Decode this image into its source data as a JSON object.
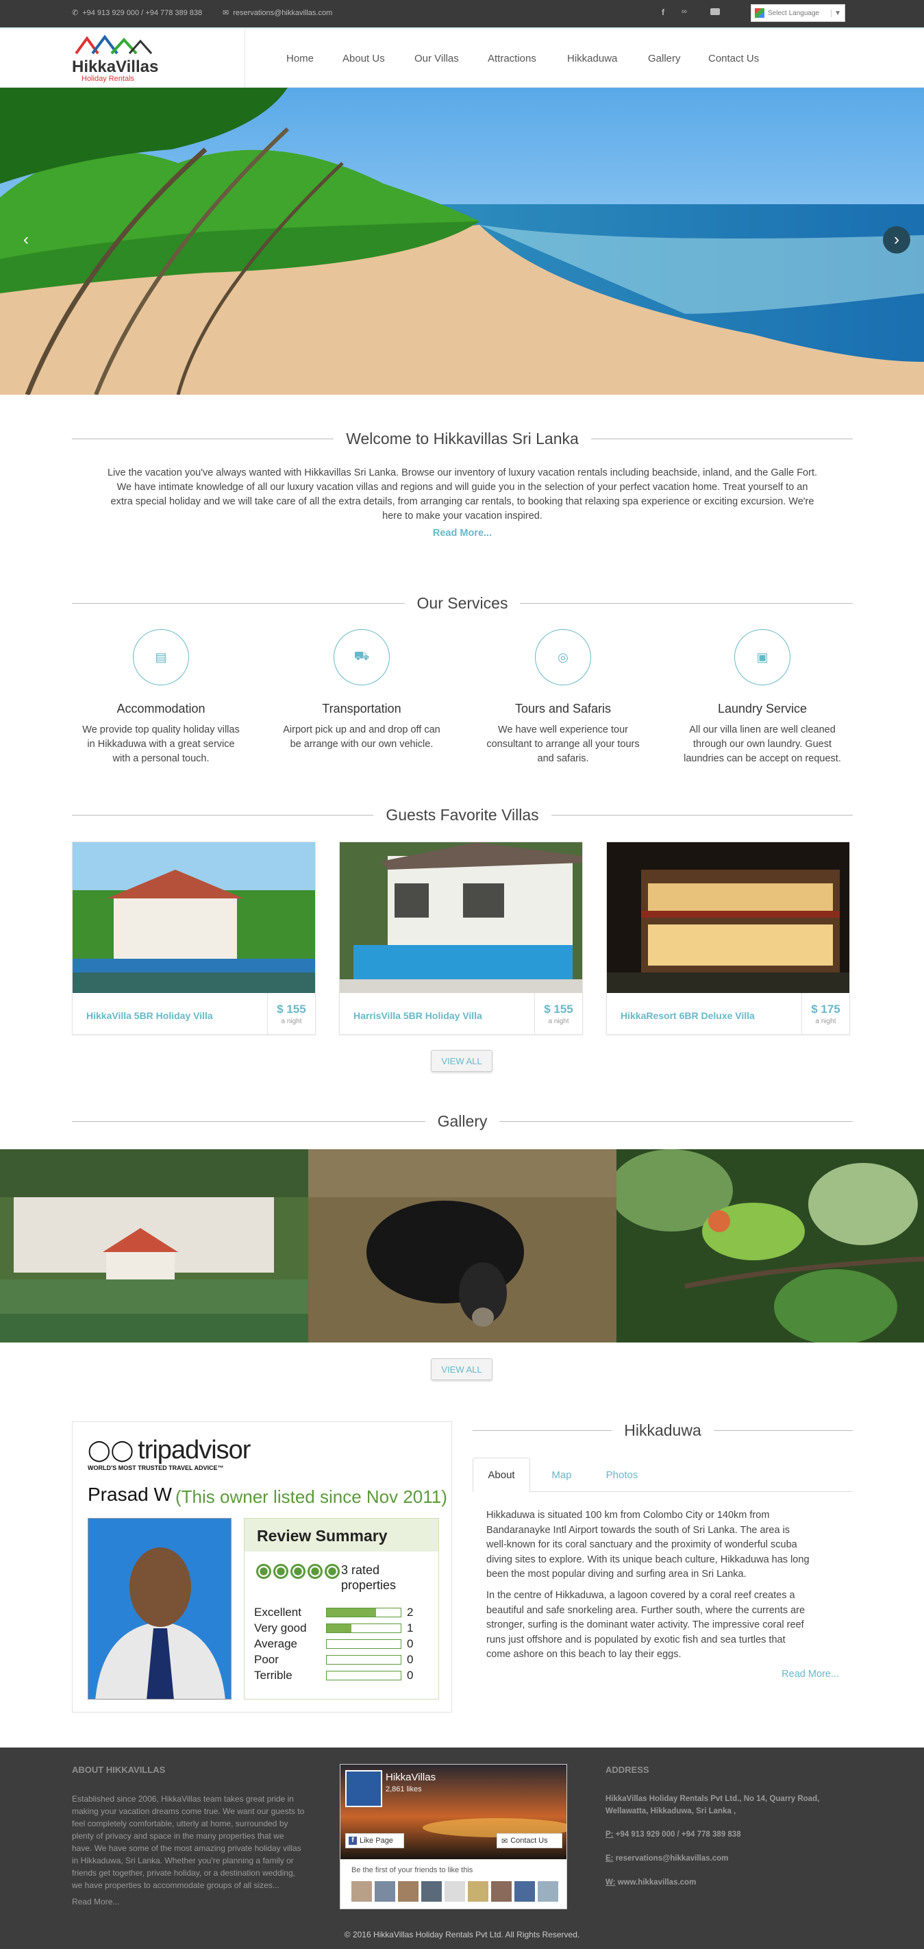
{
  "topbar": {
    "phone": "+94 913 929 000 / +94 778 389 838",
    "email": "reservations@hikkavillas.com",
    "language": "Select Language"
  },
  "brand": {
    "name": "HikkaVillas",
    "tagline": "Holiday Rentals"
  },
  "nav": [
    "Home",
    "About Us",
    "Our Villas",
    "Attractions",
    "Hikkaduwa",
    "Gallery",
    "Contact Us"
  ],
  "welcome": {
    "title": "Welcome to Hikkavillas Sri Lanka",
    "lines": [
      "Live the vacation you've always wanted with Hikkavillas Sri Lanka. Browse our inventory of luxury vacation rentals including beachside, inland, and the Galle Fort.",
      "We have intimate knowledge of all our luxury vacation villas and regions and will guide you in the selection of your perfect vacation home. Treat yourself to an",
      "extra special holiday and we will take care of all the extra details, from arranging car rentals, to booking that relaxing spa experience or exciting excursion. We're",
      "here to make your vacation inspired."
    ],
    "read_more": "Read More..."
  },
  "services": {
    "title": "Our Services",
    "items": [
      {
        "icon": "bed-icon",
        "title": "Accommodation",
        "lines": [
          "We provide top quality holiday villas",
          "in Hikkaduwa with a great service",
          "with a personal touch."
        ]
      },
      {
        "icon": "taxi-icon",
        "title": "Transportation",
        "lines": [
          "Airport pick up and and drop off can",
          "be arrange with our own vehicle."
        ]
      },
      {
        "icon": "binoculars-icon",
        "title": "Tours and Safaris",
        "lines": [
          "We have well experience tour",
          "consultant to arrange all your tours",
          "and safaris."
        ]
      },
      {
        "icon": "archive-icon",
        "title": "Laundry Service",
        "lines": [
          "All our villa linen are well cleaned",
          "through our own laundry. Guest",
          "laundries can be accept on request."
        ]
      }
    ]
  },
  "villas": {
    "title": "Guests Favorite Villas",
    "items": [
      {
        "name": "HikkaVilla 5BR Holiday Villa",
        "price": "$ 155",
        "per": "a night"
      },
      {
        "name": "HarrisVilla 5BR Holiday Villa",
        "price": "$ 155",
        "per": "a night"
      },
      {
        "name": "HikkaResort 6BR Deluxe Villa",
        "price": "$ 175",
        "per": "a night"
      }
    ],
    "view_all": "VIEW ALL"
  },
  "gallery": {
    "title": "Gallery",
    "view_all": "VIEW ALL"
  },
  "tripadvisor": {
    "logo": "tripadvisor",
    "motto": "WORLD'S MOST TRUSTED TRAVEL ADVICE™",
    "owner": "Prasad W",
    "since": "(This owner listed since Nov 2011)",
    "summary_title": "Review Summary",
    "rated": "3 rated",
    "properties": "properties",
    "reviews": [
      {
        "label": "Excellent",
        "count": "2",
        "fill": 0.67
      },
      {
        "label": "Very good",
        "count": "1",
        "fill": 0.33
      },
      {
        "label": "Average",
        "count": "0",
        "fill": 0
      },
      {
        "label": "Poor",
        "count": "0",
        "fill": 0
      },
      {
        "label": "Terrible",
        "count": "0",
        "fill": 0
      }
    ]
  },
  "hikkaduwa": {
    "title": "Hikkaduwa",
    "tabs": [
      "About",
      "Map",
      "Photos"
    ],
    "p1": [
      "Hikkaduwa is situated 100 km from Colombo City or 140km from",
      "Bandaranayke Intl Airport towards the south of Sri Lanka. The area is",
      "well-known for its coral sanctuary and the proximity of wonderful scuba",
      "diving sites to explore. With its unique beach culture, Hikkaduwa has long",
      "been the most popular diving and surfing area in Sri Lanka."
    ],
    "p2": [
      "In the centre of Hikkaduwa, a lagoon covered by a coral reef creates a",
      "beautiful and safe snorkeling area. Further south, where the currents are",
      "stronger, surfing is the dominant water activity. The impressive coral reef",
      "runs just offshore and is populated by exotic fish and sea turtles that",
      "come ashore on this beach to lay their eggs."
    ],
    "read_more": "Read More..."
  },
  "footer": {
    "about_title": "ABOUT HIKKAVILLAS",
    "about_lines": [
      "Established since 2006, HikkaVillas team takes great pride in",
      "making your vacation dreams come true. We want our guests to",
      "feel completely comfortable, utterly at home, surrounded by",
      "plenty of privacy and space in the many properties that we",
      "have. We have some of the most amazing private holiday villas",
      "in Hikkaduwa, Sri Lanka. Whether you're planning a family or",
      "friends get together, private holiday, or a destination wedding,",
      "we have properties to accommodate groups of all sizes..."
    ],
    "about_more": "Read More...",
    "fb_name": "HikkaVillas",
    "fb_likes": "2,861 likes",
    "fb_like": "Like Page",
    "fb_contact": "Contact Us",
    "fb_friends": "Be the first of your friends to like this",
    "address_title": "ADDRESS",
    "address_lines": [
      "HikkaVillas Holiday Rentals Pvt Ltd., No 14, Quarry Road,",
      "Wellawatta, Hikkaduwa, Sri Lanka ,"
    ],
    "phone_label": "P:",
    "phone": "+94 913 929 000 / +94 778 389 838",
    "email_label": "E:",
    "email": "reservations@hikkavillas.com",
    "web_label": "W:",
    "web": "www.hikkavillas.com",
    "copyright": "© 2016 HikkaVillas Holiday Rentals Pvt Ltd. All Rights Reserved."
  }
}
